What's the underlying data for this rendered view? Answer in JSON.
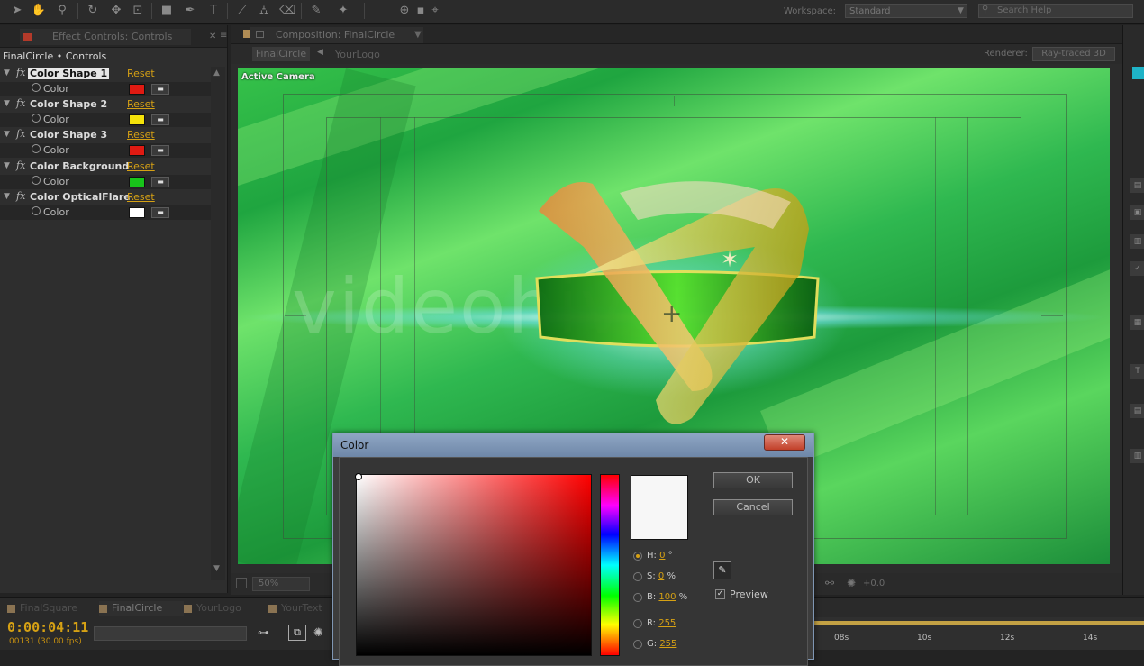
{
  "toolbar": {
    "workspace_label": "Workspace:",
    "workspace_value": "Standard",
    "search_placeholder": "Search Help"
  },
  "effect_controls": {
    "tab_label": "Effect Controls: Controls",
    "panel_title": "FinalCircle • Controls",
    "effects": [
      {
        "name": "Color Shape 1",
        "reset": "Reset",
        "prop": "Color",
        "color": "#e01a12"
      },
      {
        "name": "Color Shape 2",
        "reset": "Reset",
        "prop": "Color",
        "color": "#f4e20a"
      },
      {
        "name": "Color Shape 3",
        "reset": "Reset",
        "prop": "Color",
        "color": "#e01a12"
      },
      {
        "name": "Color Background",
        "reset": "Reset",
        "prop": "Color",
        "color": "#18c41a"
      },
      {
        "name": "Color OpticalFlare",
        "reset": "Reset",
        "prop": "Color",
        "color": "#ffffff"
      }
    ]
  },
  "composition": {
    "tab_label": "Composition: FinalCircle",
    "flow_current": "FinalCircle",
    "flow_next": "YourLogo",
    "renderer_label": "Renderer:",
    "renderer_value": "Ray-traced 3D",
    "viewer_label": "Active Camera",
    "watermark": "videohive",
    "zoom": "50%",
    "exposure": "+0.0"
  },
  "timeline": {
    "tabs": [
      "FinalSquare",
      "FinalCircle",
      "YourLogo",
      "YourText"
    ],
    "timecode": "0:00:04:11",
    "frames": "00131 (30.00 fps)",
    "ticks": [
      "08s",
      "10s",
      "12s",
      "14s"
    ]
  },
  "color_dialog": {
    "title": "Color",
    "close": "✕",
    "ok": "OK",
    "cancel": "Cancel",
    "hsb": [
      {
        "label": "H:",
        "value": "0",
        "unit": "°"
      },
      {
        "label": "S:",
        "value": "0",
        "unit": "%"
      },
      {
        "label": "B:",
        "value": "100",
        "unit": "%"
      }
    ],
    "rgb": [
      {
        "label": "R:",
        "value": "255"
      },
      {
        "label": "G:",
        "value": "255"
      }
    ],
    "preview_label": "Preview",
    "new_color": "#f7f7f7"
  }
}
